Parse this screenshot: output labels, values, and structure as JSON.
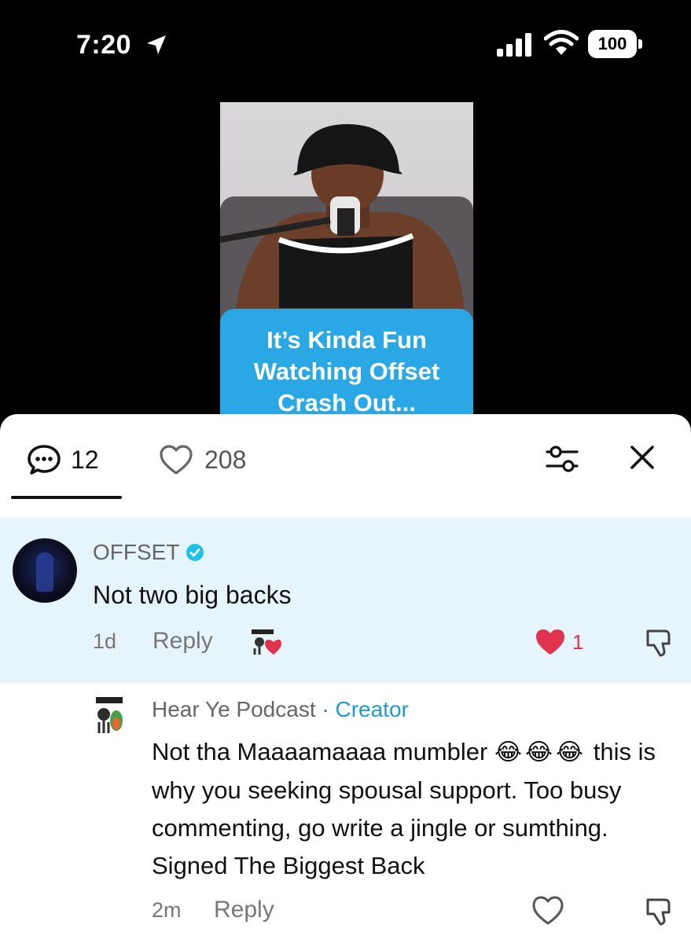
{
  "status_bar": {
    "time": "7:20",
    "battery": "100",
    "icons": [
      "location-arrow-icon",
      "signal-icon",
      "wifi-icon",
      "battery-icon"
    ]
  },
  "video": {
    "caption_lines": [
      "It’s Kinda Fun",
      "Watching Offset",
      "Crash Out..."
    ],
    "caption_color": "#2aa8e6"
  },
  "comments_header": {
    "comment_count": "12",
    "like_count": "208",
    "icons": [
      "comment-bubble-icon",
      "heart-outline-icon",
      "filter-icon",
      "close-icon"
    ]
  },
  "comments": [
    {
      "author": "OFFSET",
      "verified": true,
      "text": "Not two big backs",
      "time": "1d",
      "reply_label": "Reply",
      "liked_by_creator": true,
      "like_count": "1",
      "liked": true
    },
    {
      "author": "Hear Ye Podcast",
      "separator": " · ",
      "badge": "Creator",
      "text_before_emoji": "Not tha Maaaamaaaa mumbler",
      "emoji": "😂😂😂",
      "text_after_emoji": "this is why you seeking spousal support. Too busy commenting, go write a jingle or sumthing. Signed The Biggest Back",
      "time": "2m",
      "reply_label": "Reply",
      "liked": false
    }
  ],
  "colors": {
    "highlight": "#e6f5fb",
    "like_red": "#e0344e",
    "creator_blue": "#1e9ad6"
  }
}
